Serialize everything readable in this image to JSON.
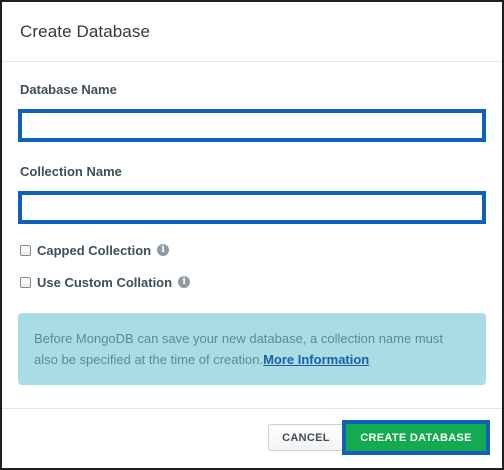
{
  "dialog": {
    "title": "Create Database"
  },
  "form": {
    "database_name_label": "Database Name",
    "database_name_value": "",
    "collection_name_label": "Collection Name",
    "collection_name_value": "",
    "capped_collection_label": "Capped Collection",
    "capped_collection_checked": false,
    "custom_collation_label": "Use Custom Collation",
    "custom_collation_checked": false,
    "info_icon": "info-icon"
  },
  "banner": {
    "text": "Before MongoDB can save your new database, a collection name must also be specified at the time of creation.",
    "link_text": "More Information"
  },
  "footer": {
    "cancel_label": "CANCEL",
    "create_label": "CREATE DATABASE"
  },
  "colors": {
    "focus_outline": "#1061b9",
    "primary_button": "#13aa52",
    "banner_background": "#a9dde3",
    "link": "#1a5fa8"
  }
}
